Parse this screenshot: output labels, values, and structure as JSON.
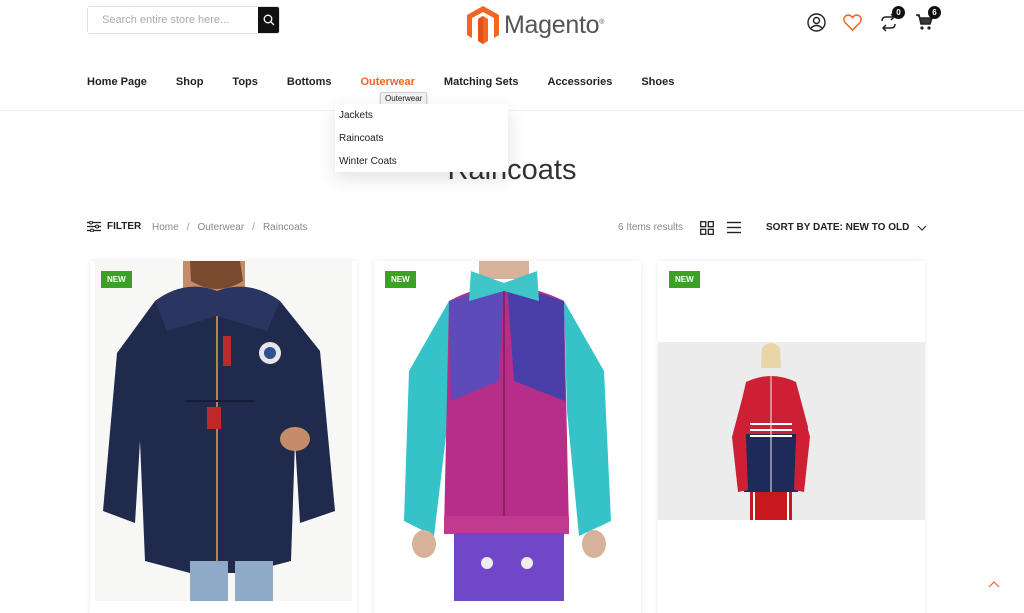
{
  "header": {
    "search_placeholder": "Search entire store here...",
    "logo_text": "Magento",
    "compare_count": "0",
    "cart_count": "6"
  },
  "nav": {
    "items": [
      "Home Page",
      "Shop",
      "Tops",
      "Bottoms",
      "Outerwear",
      "Matching Sets",
      "Accessories",
      "Shoes"
    ],
    "active_tooltip": "Outerwear"
  },
  "dropdown": {
    "items": [
      "Jackets",
      "Raincoats",
      "Winter Coats"
    ]
  },
  "page": {
    "title": "Raincoats"
  },
  "toolbar": {
    "filter_label": "FILTER",
    "breadcrumb": [
      "Home",
      "Outerwear",
      "Raincoats"
    ],
    "results": "6 Items results",
    "sort_label": "SORT BY DATE: NEW TO OLD"
  },
  "products": [
    {
      "badge": "NEW"
    },
    {
      "badge": "NEW"
    },
    {
      "badge": "NEW"
    }
  ],
  "colors": {
    "accent": "#f26522",
    "badge_green": "#3ba226",
    "dark": "#111111"
  },
  "icons": [
    "search-icon",
    "user-icon",
    "heart-icon",
    "compare-icon",
    "cart-icon",
    "filter-icon",
    "grid-view-icon",
    "list-view-icon",
    "chevron-down-icon",
    "chevron-up-icon"
  ]
}
